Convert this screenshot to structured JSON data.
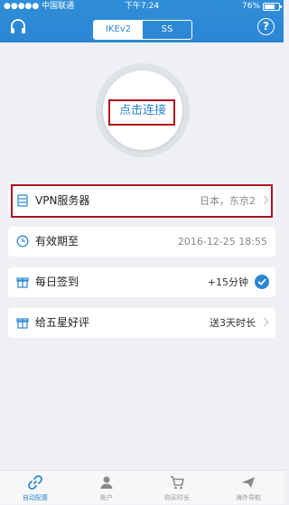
{
  "status_bar": {
    "carrier": "●●●●● 中国联通",
    "time": "下午7:24",
    "battery": "76%",
    "battery_level": 0.76
  },
  "header": {
    "tabs": [
      {
        "label": "IKEv2",
        "active": true
      },
      {
        "label": "SS",
        "active": false
      }
    ],
    "left_icon": "headset-icon",
    "right_icon": "help-icon",
    "help_symbol": "?"
  },
  "connect": {
    "label": "点击连接"
  },
  "rows": [
    {
      "icon": "server-icon",
      "label": "VPN服务器",
      "value": "日本，东京2",
      "has_chevron": true
    },
    {
      "icon": "clock-icon",
      "label": "有效期至",
      "value": "2016-12-25 18:55",
      "has_chevron": false
    },
    {
      "icon": "gift-icon",
      "label": "每日签到",
      "value": "+15分钟",
      "has_check": true
    },
    {
      "icon": "gift-icon",
      "label": "给五星好评",
      "value": "送3天时长",
      "has_chevron": true
    }
  ],
  "tabbar": {
    "items": [
      {
        "label": "自动配置",
        "icon": "link-icon",
        "active": true
      },
      {
        "label": "账户",
        "icon": "person-icon",
        "active": false
      },
      {
        "label": "购买时长",
        "icon": "cart-icon",
        "active": false
      },
      {
        "label": "海外导航",
        "icon": "paper-plane-icon",
        "active": false
      }
    ]
  },
  "colors": {
    "accent": "#2b86d3",
    "highlight_box": "#b10f1e",
    "background": "#eef0f4"
  }
}
